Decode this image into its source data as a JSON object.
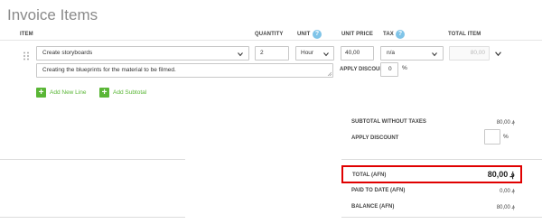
{
  "section_title": "Invoice Items",
  "columns": {
    "item": "ITEM",
    "quantity": "QUANTITY",
    "unit": "UNIT",
    "unit_price": "UNIT PRICE",
    "tax": "TAX",
    "total_item": "TOTAL ITEM"
  },
  "line": {
    "item": "Create storyboards",
    "description": "Creating the blueprints for the material to be filmed.",
    "quantity": "2",
    "unit": "Hour",
    "unit_price": "40,00",
    "tax": "n/a",
    "total_placeholder": "80,00",
    "apply_discount_label": "APPLY DISCOUNT",
    "discount_value": "0",
    "discount_unit": "%"
  },
  "actions": {
    "add_new_line": "Add New Line",
    "add_subtotal": "Add Subtotal"
  },
  "summary": {
    "subtotal_label": "SUBTOTAL WITHOUT TAXES",
    "subtotal_value": "80,00 ؋",
    "apply_discount_label": "APPLY DISCOUNT",
    "discount_unit": "%",
    "total_label": "TOTAL (AFN)",
    "total_value": "80,00 ؋",
    "paid_label": "PAID TO DATE (AFN)",
    "paid_value": "0,00 ؋",
    "balance_label": "BALANCE (AFN)",
    "balance_value": "80,00 ؋"
  },
  "colors": {
    "accent_green": "#5ab636",
    "highlight_red": "#e00000",
    "help_blue": "#7fc4e8"
  }
}
